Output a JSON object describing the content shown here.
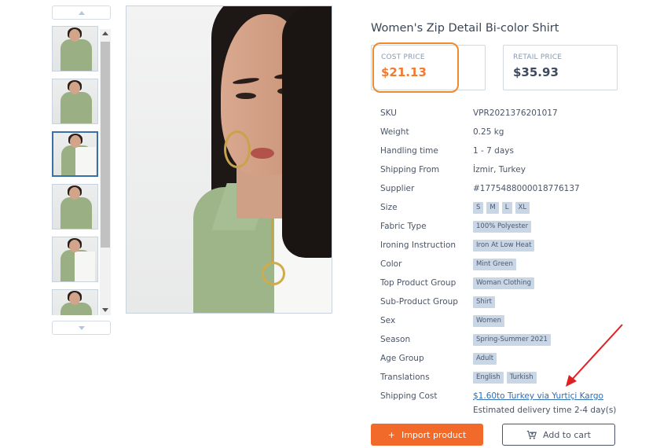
{
  "gallery": {
    "thumbs": [
      "thumb-1",
      "thumb-2",
      "thumb-3",
      "thumb-4",
      "thumb-5",
      "thumb-6"
    ],
    "active_index": 2
  },
  "product": {
    "title": "Women's Zip Detail Bi-color Shirt",
    "cost_price_label": "COST PRICE",
    "cost_price": "$21.13",
    "retail_price_label": "RETAIL PRICE",
    "retail_price": "$35.93"
  },
  "specs": {
    "sku_label": "SKU",
    "sku": "VPR2021376201017",
    "weight_label": "Weight",
    "weight": "0.25 kg",
    "handling_label": "Handling time",
    "handling": "1 - 7 days",
    "shipping_from_label": "Shipping From",
    "shipping_from": "İzmir, Turkey",
    "supplier_label": "Supplier",
    "supplier": "#1775488000018776137",
    "size_label": "Size",
    "sizes": [
      "S",
      "M",
      "L",
      "XL"
    ],
    "fabric_label": "Fabric Type",
    "fabric": "100% Polyester",
    "ironing_label": "Ironing Instruction",
    "ironing": "Iron At Low Heat",
    "color_label": "Color",
    "color": "Mint Green",
    "top_group_label": "Top Product Group",
    "top_group": "Woman Clothing",
    "sub_group_label": "Sub-Product Group",
    "sub_group": "Shirt",
    "sex_label": "Sex",
    "sex": "Women",
    "season_label": "Season",
    "season": "Spring-Summer 2021",
    "age_label": "Age Group",
    "age": "Adult",
    "translations_label": "Translations",
    "translations": [
      "English",
      "Turkish"
    ],
    "shipping_cost_label": "Shipping Cost",
    "shipping_cost_link": "$1.60to Turkey via Yurtiçi Kargo",
    "delivery_note": "Estimated delivery time 2-4 day(s)"
  },
  "actions": {
    "import_label": "Import product",
    "cart_label": "Add to cart"
  },
  "colors": {
    "accent_orange": "#f26a2a",
    "highlight_orange": "#f08a2e",
    "tag_bg": "#c9d6e6",
    "link_blue": "#2e6db4",
    "annotation_arrow": "#e02020"
  }
}
